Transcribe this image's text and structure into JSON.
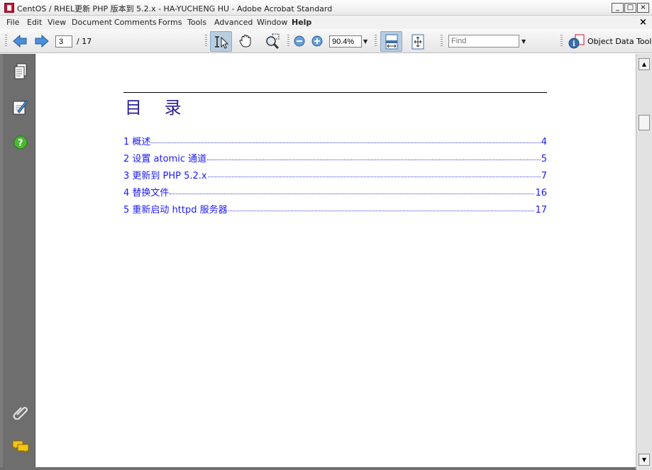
{
  "window": {
    "title": "CentOS / RHEL更新 PHP 版本到 5.2.x - HA-YUCHENG HU - Adobe Acrobat Standard",
    "min_label": "_",
    "max_label": "□",
    "close_label": "×"
  },
  "menu": {
    "items": [
      "File",
      "Edit",
      "View",
      "Document",
      "Comments",
      "Forms",
      "Tools",
      "Advanced",
      "Window",
      "Help"
    ],
    "close_label": "×"
  },
  "toolbar": {
    "page_current": "3",
    "page_total": "/  17",
    "zoom": "90.4%",
    "find_placeholder": "Find",
    "object_data_tool": "Object Data Tool"
  },
  "document": {
    "toc_title": "目 录",
    "toc_entries": [
      {
        "label": "1 概述",
        "page": "4"
      },
      {
        "label": "2 设置  atomic 通道",
        "page": "5"
      },
      {
        "label": "3 更新到  PHP 5.2.x",
        "page": "7"
      },
      {
        "label": "4 替换文件",
        "page": "16"
      },
      {
        "label": "5 重新启动  httpd 服务器",
        "page": "17"
      }
    ]
  },
  "icons": {
    "back": "back-arrow-icon",
    "forward": "forward-arrow-icon",
    "select": "select-text-icon",
    "hand": "hand-icon",
    "zoom": "zoom-marquee-icon",
    "zoom_out": "zoom-out-icon",
    "zoom_in": "zoom-in-icon",
    "fit_width": "fit-width-icon",
    "fit_page": "fit-page-icon",
    "object_data": "object-data-icon",
    "pages": "pages-icon",
    "signatures": "signature-icon",
    "help": "help-icon",
    "attachments": "paperclip-icon",
    "comments": "comments-icon"
  },
  "colors": {
    "toc_text": "#1a1aff",
    "toc_title": "#2a2096",
    "navpane": "#6e6e6e",
    "accent_active": "#b9cde0"
  }
}
